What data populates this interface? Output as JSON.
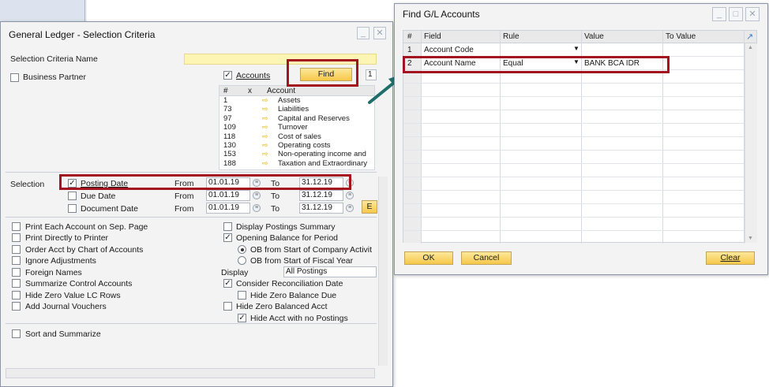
{
  "gl_window": {
    "title": "General Ledger - Selection Criteria",
    "selection_criteria_name_label": "Selection Criteria Name",
    "business_partner_label": "Business Partner",
    "accounts_label": "Accounts",
    "find_label": "Find",
    "find_side_value": "1",
    "account_table": {
      "headers": [
        "#",
        "x",
        "Account"
      ],
      "rows": [
        {
          "num": "1",
          "name": "Assets"
        },
        {
          "num": "73",
          "name": "Liabilities"
        },
        {
          "num": "97",
          "name": "Capital and Reserves"
        },
        {
          "num": "109",
          "name": "Turnover"
        },
        {
          "num": "118",
          "name": "Cost of sales"
        },
        {
          "num": "130",
          "name": "Operating costs"
        },
        {
          "num": "153",
          "name": "Non-operating income and"
        },
        {
          "num": "188",
          "name": "Taxation and Extraordinary"
        }
      ]
    },
    "selection_label": "Selection",
    "date_rows": [
      {
        "label": "Posting Date",
        "checked": true,
        "from_label": "From",
        "from": "01.01.19",
        "to_label": "To",
        "to": "31.12.19"
      },
      {
        "label": "Due Date",
        "checked": false,
        "from_label": "From",
        "from": "01.01.19",
        "to_label": "To",
        "to": "31.12.19"
      },
      {
        "label": "Document Date",
        "checked": false,
        "from_label": "From",
        "from": "01.01.19",
        "to_label": "To",
        "to": "31.12.19"
      }
    ],
    "cut_button_label": "E",
    "left_options": [
      "Print Each Account on Sep. Page",
      "Print Directly to Printer",
      "Order Acct by Chart of Accounts",
      "Ignore Adjustments",
      "Foreign Names",
      "Summarize Control Accounts",
      "Hide Zero Value LC Rows",
      "Add Journal Vouchers"
    ],
    "display_postings_summary": "Display Postings Summary",
    "opening_balance": "Opening Balance for Period",
    "ob_company": "OB from Start of Company Activit",
    "ob_fiscal": "OB from Start of Fiscal Year",
    "display_label": "Display",
    "display_value": "All Postings",
    "consider_reconciliation": "Consider Reconciliation Date",
    "hide_zero_balance_due": "Hide Zero Balance Due",
    "hide_zero_balanced_acct": "Hide Zero Balanced Acct",
    "hide_acct_no_postings": "Hide Acct with no Postings",
    "sort_and_summarize": "Sort and Summarize"
  },
  "find_window": {
    "title": "Find G/L Accounts",
    "headers": [
      "#",
      "Field",
      "Rule",
      "Value",
      "To Value"
    ],
    "rows": [
      {
        "num": "1",
        "field": "Account Code",
        "rule": "",
        "value": "",
        "to_value": ""
      },
      {
        "num": "2",
        "field": "Account Name",
        "rule": "Equal",
        "value": "BANK BCA IDR",
        "to_value": ""
      }
    ],
    "ok_label": "OK",
    "cancel_label": "Cancel",
    "clear_label": "Clear"
  },
  "colors": {
    "highlight": "#a4141e",
    "button": "#f6c74a",
    "arrow": "#1f6e6a"
  }
}
